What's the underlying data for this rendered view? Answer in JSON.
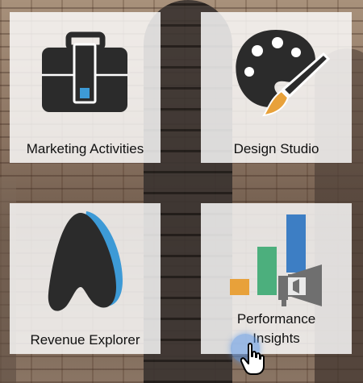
{
  "tiles": [
    {
      "label": "Marketing Activities",
      "icon": "briefcase-icon"
    },
    {
      "label": "Design Studio",
      "icon": "palette-brush-icon"
    },
    {
      "label": "Revenue Explorer",
      "icon": "revenue-explorer-icon"
    },
    {
      "label": "Performance Insights",
      "icon": "bar-chart-megaphone-icon"
    }
  ],
  "colors": {
    "icon_dark": "#2b2b2b",
    "accent_blue": "#3d9ad6",
    "accent_orange": "#e8a13a",
    "accent_green": "#4caf7d",
    "accent_darkblue": "#3d7ec4",
    "icon_gray": "#6f6f6f"
  }
}
